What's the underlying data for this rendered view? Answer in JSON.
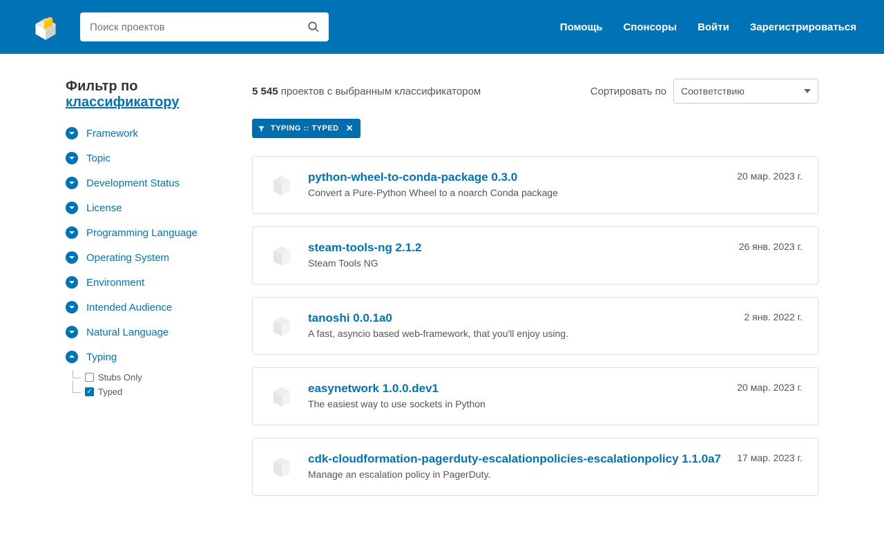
{
  "header": {
    "search_placeholder": "Поиск проектов",
    "nav": [
      "Помощь",
      "Спонсоры",
      "Войти",
      "Зарегистрироваться"
    ]
  },
  "sidebar": {
    "filter_label": "Фильтр по ",
    "filter_link": "классификатору",
    "facets": [
      {
        "label": "Framework",
        "expanded": false
      },
      {
        "label": "Topic",
        "expanded": false
      },
      {
        "label": "Development Status",
        "expanded": false
      },
      {
        "label": "License",
        "expanded": false
      },
      {
        "label": "Programming Language",
        "expanded": false
      },
      {
        "label": "Operating System",
        "expanded": false
      },
      {
        "label": "Environment",
        "expanded": false
      },
      {
        "label": "Intended Audience",
        "expanded": false
      },
      {
        "label": "Natural Language",
        "expanded": false
      },
      {
        "label": "Typing",
        "expanded": true
      }
    ],
    "typing_options": [
      {
        "label": "Stubs Only",
        "checked": false
      },
      {
        "label": "Typed",
        "checked": true
      }
    ]
  },
  "results": {
    "count": "5 545",
    "count_suffix": " проектов с выбранным классификатором",
    "sort_label": "Сортировать по",
    "sort_value": "Соответствию",
    "chip_label": "TYPING :: TYPED",
    "items": [
      {
        "title": "python-wheel-to-conda-package 0.3.0",
        "desc": "Convert a Pure-Python Wheel to a noarch Conda package",
        "date": "20 мар. 2023 г."
      },
      {
        "title": "steam-tools-ng 2.1.2",
        "desc": "Steam Tools NG",
        "date": "26 янв. 2023 г."
      },
      {
        "title": "tanoshi 0.0.1a0",
        "desc": "A fast, asyncio based web-framework, that you'll enjoy using.",
        "date": "2 янв. 2022 г."
      },
      {
        "title": "easynetwork 1.0.0.dev1",
        "desc": "The easiest way to use sockets in Python",
        "date": "20 мар. 2023 г."
      },
      {
        "title": "cdk-cloudformation-pagerduty-escalationpolicies-escalationpolicy 1.1.0a7",
        "desc": "Manage an escalation policy in PagerDuty.",
        "date": "17 мар. 2023 г."
      }
    ]
  }
}
